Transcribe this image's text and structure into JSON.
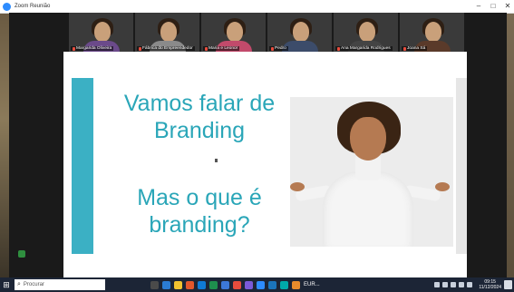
{
  "window": {
    "title": "Zoom Reunião",
    "controls": [
      "–",
      "□",
      "✕"
    ]
  },
  "participants": [
    {
      "name": "Margarida Oliveira",
      "shirt": "#6b4a8a"
    },
    {
      "name": "Fábrica do Empreendedor",
      "shirt": "#8a8a8a"
    },
    {
      "name": "Maria e Leonor",
      "shirt": "#c24a6b"
    },
    {
      "name": "Pedro",
      "shirt": "#3c4c6a"
    },
    {
      "name": "Ana Margarida Rodrigues",
      "shirt": "#444444"
    },
    {
      "name": "Joana Sá",
      "shirt": "#5a3a2a"
    }
  ],
  "slide": {
    "title_lines": [
      "Vamos falar de",
      "Branding"
    ],
    "subtitle_lines": [
      "Mas o que é",
      "branding?"
    ]
  },
  "taskbar": {
    "search_placeholder": "Procurar",
    "eur_label": "EUR...",
    "clock_time": "09:15",
    "clock_date": "11/12/2024",
    "app_colors": [
      "#4a4a4a",
      "#2b7cd3",
      "#f2c330",
      "#e2572c",
      "#0f7ad6",
      "#1e8f4e",
      "#3c78d8",
      "#e84c3d",
      "#7a5ad8",
      "#2d8cff",
      "#1b75bc",
      "#0aa",
      "#e88c2c"
    ]
  },
  "colors": {
    "accent": "#3bb0c4",
    "title_text": "#2aa6b8"
  }
}
